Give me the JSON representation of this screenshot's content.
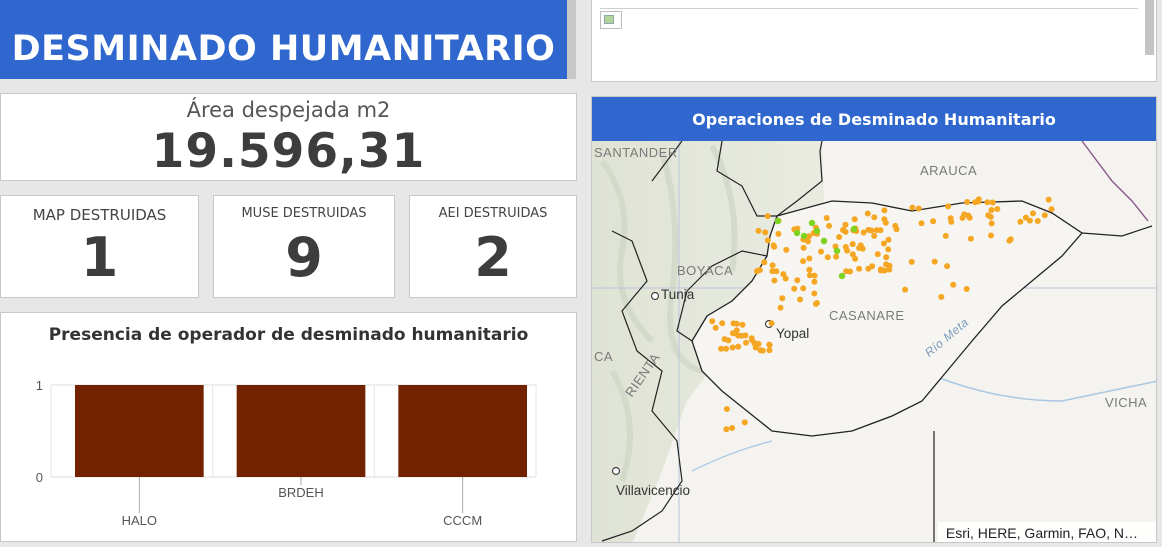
{
  "header": {
    "title": "DESMINADO HUMANITARIO"
  },
  "indicators": {
    "area": {
      "label": "Área despejada m2",
      "value": "19.596,31"
    },
    "map": {
      "label": "MAP DESTRUIDAS",
      "value": "1"
    },
    "muse": {
      "label": "MUSE DESTRUIDAS",
      "value": "9"
    },
    "aei": {
      "label": "AEI DESTRUIDAS",
      "value": "2"
    }
  },
  "chart_data": {
    "type": "bar",
    "title": "Presencia de operador de desminado humanitario",
    "categories": [
      "HALO",
      "BRDEH",
      "CCCM"
    ],
    "values": [
      1,
      1,
      1
    ],
    "ylim": [
      0,
      1
    ],
    "yticks": [
      "1",
      "0"
    ],
    "bar_color": "#732200",
    "xlabel": "",
    "ylabel": ""
  },
  "map": {
    "title": "Operaciones de Desminado Humanitario",
    "labels": {
      "santander": "SANTANDER",
      "arauca": "ARAUCA",
      "boyaca": "BOYACA",
      "casanare": "CASANARE",
      "vichada": "VICHA",
      "tunja": "Tunja",
      "yopal": "Yopal",
      "villavicencio": "Villavicencio",
      "rio_meta": "Río Meta",
      "ca": "CA",
      "rienta": "RIENTA"
    },
    "attribution": "Esri, HERE, Garmin, FAO, N…",
    "colors": {
      "point_orange": "#f5a623",
      "point_green": "#7ed321",
      "boundary": "#222222"
    }
  }
}
